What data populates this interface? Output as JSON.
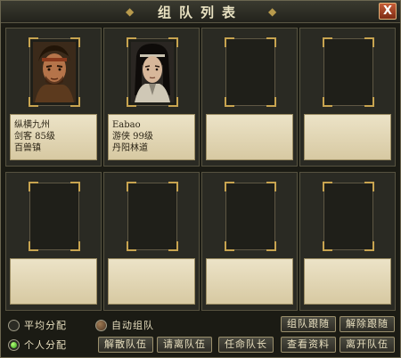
{
  "window": {
    "title": "组队列表",
    "close_label": "X"
  },
  "members": [
    {
      "name": "纵横九州",
      "class_level": "剑客  85级",
      "location": "百兽镇",
      "portrait": "warrior-portrait"
    },
    {
      "name": "Eabao",
      "class_level": "游侠  99级",
      "location": "丹阳林道",
      "portrait": "swordsman-portrait"
    },
    {
      "name": "",
      "class_level": "",
      "location": ""
    },
    {
      "name": "",
      "class_level": "",
      "location": ""
    },
    {
      "name": "",
      "class_level": "",
      "location": ""
    },
    {
      "name": "",
      "class_level": "",
      "location": ""
    },
    {
      "name": "",
      "class_level": "",
      "location": ""
    },
    {
      "name": "",
      "class_level": "",
      "location": ""
    }
  ],
  "distribution": {
    "option1": "平均分配",
    "option2": "个人分配",
    "auto_team": "自动组队"
  },
  "buttons": {
    "follow": "组队跟随",
    "unfollow": "解除跟随",
    "disband": "解散队伍",
    "kick": "请离队伍",
    "appoint": "任命队长",
    "view": "查看资料",
    "leave": "离开队伍"
  },
  "colors": {
    "panel": "#2a2a23",
    "info_bg": "#e6dcbd",
    "corner_gold": "#c8a450",
    "radio_active": "#3fbf1f"
  }
}
